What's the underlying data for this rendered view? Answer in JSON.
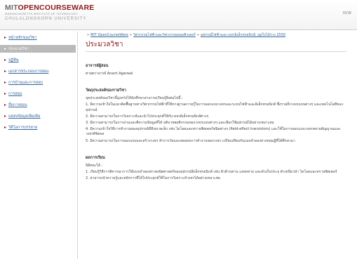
{
  "header": {
    "logo_prefix": "MIT",
    "logo_main": "OPENCOURSEWARE",
    "logo_sub1": "MASSACHUSETTS INSTITUTE OF TECHNOLOGY",
    "logo_sub2": "CHULALONGKORN UNIVERSITY",
    "lang_link": "OCW"
  },
  "sidebar": {
    "items": [
      {
        "label": "หน้าหลักของวิชา"
      },
      {
        "label": "ประมวลวิชา"
      },
      {
        "label": "ปฏิทิน"
      },
      {
        "label": "เอกสารประกอบการสอน"
      },
      {
        "label": "การบ้านและการสอบ"
      },
      {
        "label": "การสอบ"
      },
      {
        "label": "สื่อการสอน"
      },
      {
        "label": "แหล่งข้อมูลเพิ่มเติม"
      },
      {
        "label": "วิดีโอการบรรยาย"
      }
    ]
  },
  "breadcrumb": {
    "home": "MIT OpenCourseWare",
    "sep": "»",
    "dept": "วิศวกรรมไฟฟ้าและวิศวกรรมคอมพิวเตอร์",
    "course": "อุปกรณ์ไฟฟ้าและวงจรอิเล็กทรอนิกส์, ฤดูใบไม้ร่วง 2550"
  },
  "page_title": "ประมวลวิชา",
  "sections": {
    "instructor_head": "อาจารย์ผู้สอน",
    "instructor_text": "ศาสตราจารย์ Anant Agarwal",
    "objectives_head": "วัตถุประสงค์ของรายวิชา",
    "objectives_intro": "จุดประสงค์ของวิชานี้มุ่งหวังให้นักศึกษาสามารถเรียนรู้สิ่งต่อไปนี้ :",
    "objectives": [
      "1. มีความเข้าใจในแนวคิดพื้นฐานทางวิศวกรรมไฟฟ้าที่ใช้ทางฐานความรู้ในการออกแบบวงจรและระบบไฟฟ้าและอิเล็กทรอนิกส์ ซึ่งรวมถึงวงจรแบบต่างๆ และเทคโนโลยีของอุปกรณ์",
      "2. มีความสามารถในการวิเคราะห์และนำไปประยุกต์ใช้กับวงจรอิเล็กทรอนิกส์ต่างๆ",
      "3. มีความสามารถในการอ่านและตีความข้อมูลที่ได้ อธิบายพฤติกรรมของวงจรแบบต่างๆ และเลือกใช้อุปกรณ์ได้อย่างเหมาะสม",
      "4. มีความเข้าใจวิธีการทำงานของอุปกรณ์ที่มีขนาดเล็ก เช่น ไดโอดและทรานซิสเตอร์ชนิดต่างๆ (field-effect transistors) และใช้ในการออกแบบวงจรขยายสัญญาณและวงจรดิจิตอล",
      "5. มีความสามารถในการออกแบบและสร้างวงจร ทำการวัดและทดสอบการทำงานของวงจร เปรียบเทียบกับแบบจำลองทางทฤษฎีที่ได้ศึกษามา"
    ],
    "outcomes_head": "ผลการเรียน",
    "outcomes_intro": "นิสิตจะได้ :",
    "outcomes": [
      "1. เรียนรู้วิธีการพิจารณาการใช้แบบจำลองทางคณิตศาสตร์ของอุปกรณ์อิเล็กทรอนิกส์ เช่น ตัวต้านทาน แหล่งจ่าย และตัวเก็บประจุ ตัวเหนี่ยวนำ ไดโอดและทรานซิสเตอร์",
      "2. สามารถนำความรู้และหลักการที่ได้ไปประยุกต์ใช้ในการวิเคราะห์วงจรได้อย่างเหมาะสม"
    ]
  }
}
